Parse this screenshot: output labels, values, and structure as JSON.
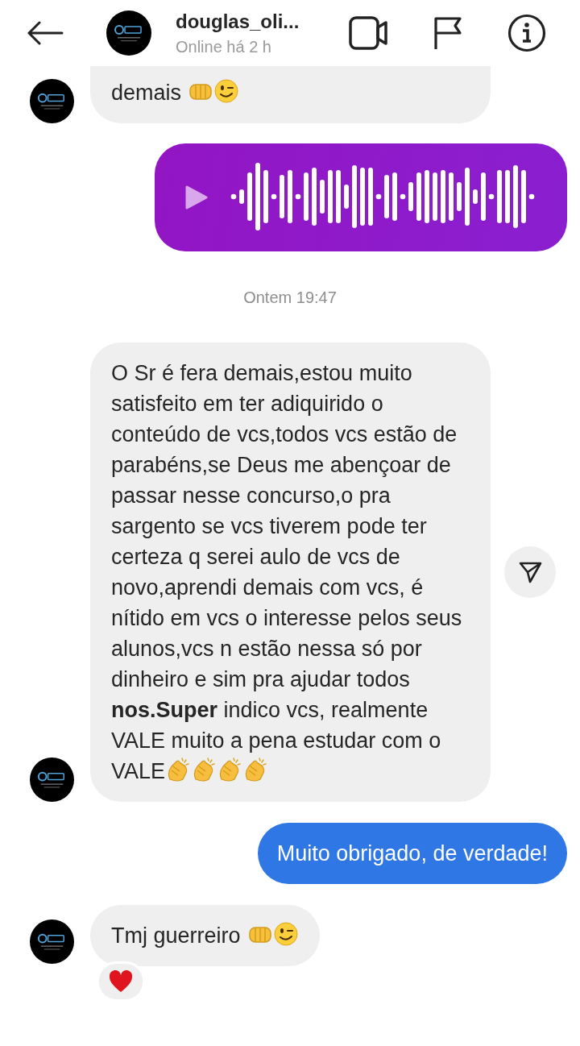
{
  "header": {
    "name": "douglas_oli...",
    "status": "Online há 2 h"
  },
  "messages": [
    {
      "kind": "text",
      "outgoing": false,
      "text": "demais",
      "emoji": [
        {
          "kind": "fist"
        },
        {
          "kind": "wink"
        }
      ],
      "avatar": true,
      "clipped": true
    },
    {
      "kind": "voice",
      "outgoing": true
    },
    {
      "kind": "timestamp",
      "text": "Ontem 19:47"
    },
    {
      "kind": "text",
      "outgoing": false,
      "text": "O Sr é fera demais,estou muito satisfeito em ter adiquirido o conteúdo de vcs,todos vcs estão de parabéns,se Deus me abençoar de passar nesse concurso,o pra sargento se vcs tiverem pode ter certeza q serei aulo de vcs de novo,aprendi demais com vcs, é nítido em vcs o interesse pelos seus alunos,vcs n estão nessa só por dinheiro e sim pra ajudar todos **nos.Super** indico vcs, realmente VALE muito a pena estudar com o VALE",
      "emoji": [
        {
          "kind": "clap"
        },
        {
          "kind": "clap"
        },
        {
          "kind": "clap"
        },
        {
          "kind": "clap"
        }
      ],
      "avatar": true,
      "share": true
    },
    {
      "kind": "text",
      "outgoing": true,
      "text": "Muito obrigado, de verdade!"
    },
    {
      "kind": "text",
      "outgoing": false,
      "text": "Tmj guerreiro",
      "emoji": [
        {
          "kind": "fist"
        },
        {
          "kind": "wink"
        }
      ],
      "avatar": true,
      "reaction": {
        "kind": "heart"
      }
    }
  ]
}
